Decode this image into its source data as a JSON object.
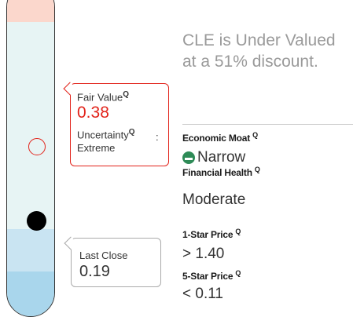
{
  "valuation_tube": {
    "band_colors": [
      "#fbd7cc",
      "#e7f4f4",
      "#c9e4f2",
      "#a9d6ec"
    ],
    "fair_value_marker_color": "#e2231a",
    "last_close_marker_color": "#000000"
  },
  "fair_value_callout": {
    "label": "Fair Value",
    "q_mark": "Q",
    "value": "0.38",
    "uncertainty_label": "Uncertainty",
    "uncertainty_q": "Q",
    "colon": ":",
    "uncertainty_value": "Extreme"
  },
  "last_close_callout": {
    "label": "Last Close",
    "value": "0.19"
  },
  "summary": {
    "headline": "CLE is Under Valued at a 51% discount."
  },
  "metrics": {
    "moat_label": "Economic Moat",
    "moat_q": "Q",
    "moat_value": "Narrow",
    "moat_icon": "narrow-moat-icon",
    "health_label": "Financial Health",
    "health_q": "Q",
    "health_value": "Moderate",
    "one_star_label": "1-Star Price",
    "one_star_q": "Q",
    "one_star_value": "> 1.40",
    "five_star_label": "5-Star Price",
    "five_star_q": "Q",
    "five_star_value": "< 0.11"
  },
  "colors": {
    "accent_red": "#e2231a",
    "moat_green": "#2e8b57",
    "headline_gray": "#9a9a9a"
  }
}
